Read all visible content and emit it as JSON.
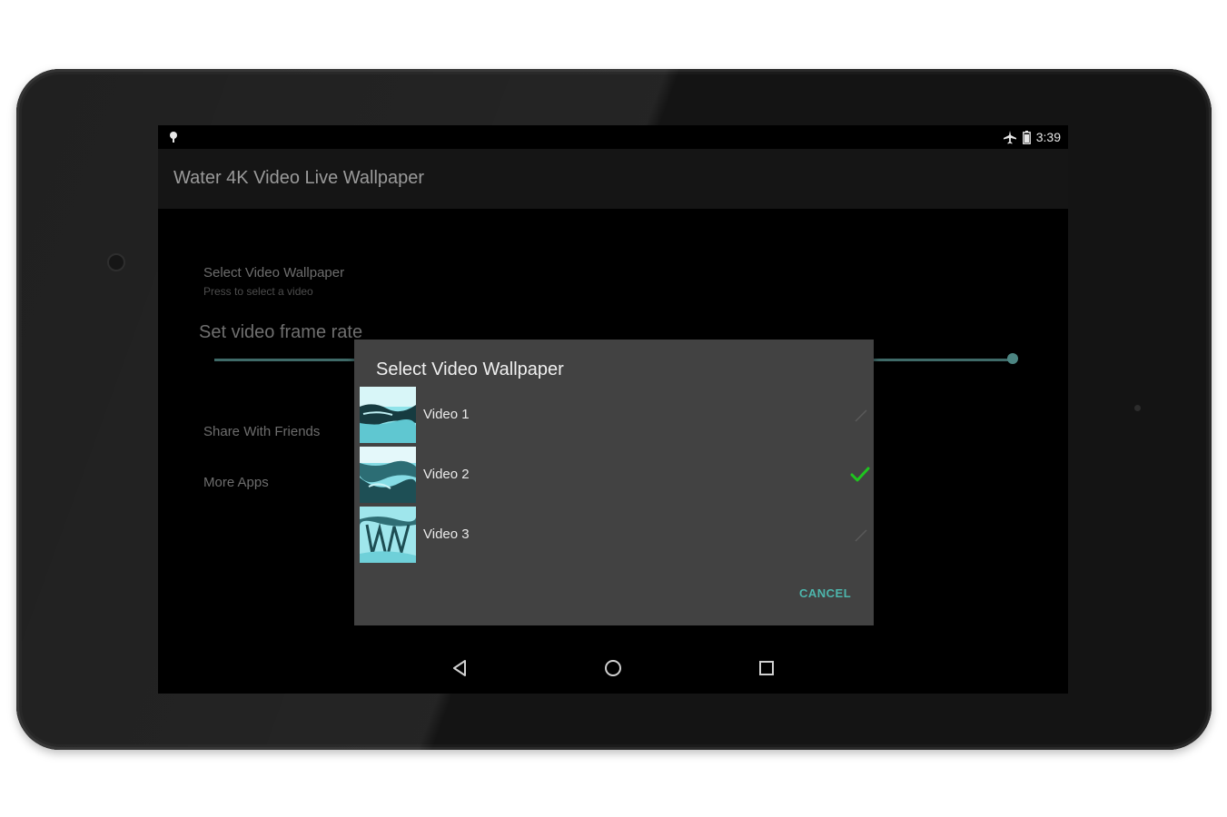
{
  "status_bar": {
    "time": "3:39"
  },
  "app_bar": {
    "title": "Water 4K Video Live Wallpaper"
  },
  "preferences": {
    "select_video": {
      "title": "Select Video Wallpaper",
      "summary": "Press to select a video"
    },
    "frame_rate": {
      "title": "Set video frame rate"
    },
    "share": {
      "title": "Share With Friends"
    },
    "more_apps": {
      "title": "More Apps"
    }
  },
  "dialog": {
    "title": "Select Video Wallpaper",
    "items": [
      {
        "label": "Video 1",
        "selected": false
      },
      {
        "label": "Video 2",
        "selected": true
      },
      {
        "label": "Video 3",
        "selected": false
      }
    ],
    "cancel_label": "CANCEL"
  },
  "nav_bar": {
    "back_icon": "back-triangle-icon",
    "home_icon": "home-circle-icon",
    "recents_icon": "recents-square-icon"
  },
  "colors": {
    "accent": "#4db6ac",
    "check": "#1fc41f",
    "dialog_bg": "#424242"
  }
}
